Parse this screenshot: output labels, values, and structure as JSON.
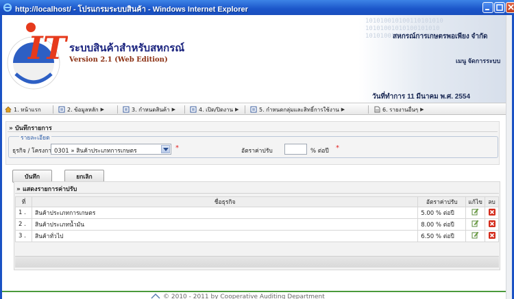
{
  "window": {
    "title": "http://localhost/ - โปรแกรมระบบสินค้า - Windows Internet Explorer"
  },
  "banner": {
    "app_title": "ระบบสินค้าสำหรับสหกรณ์",
    "version": "Version 2.1 (Web Edition)",
    "org_name": "สหกรณ์การเกษตรพอเพียง จำกัด",
    "user_menu": "เมนู จัดการระบบ",
    "work_date": "วันที่ทำการ 11 มีนาคม พ.ศ. 2554",
    "binary_bg": "101010010100110101010\n10101001010100101010\n1010100101010010101"
  },
  "menu": {
    "items": [
      {
        "label": "1. หน้าแรก",
        "icon": "home-icon"
      },
      {
        "label": "2. ข้อมูลหลัก",
        "icon": "form-icon"
      },
      {
        "label": "3. กำหนดสินค้า",
        "icon": "form-icon"
      },
      {
        "label": "4. เปิด/ปิดงาน",
        "icon": "form-icon"
      },
      {
        "label": "5. กำหนดกลุ่มและสิทธิ์การใช้งาน",
        "icon": "form-icon"
      },
      {
        "label": "6. รายงานอื่นๆ",
        "icon": "report-icon"
      }
    ]
  },
  "form": {
    "heading": "» บันทึกรายการ",
    "legend": "รายละเอียด",
    "business_label": "ธุรกิจ / โครงการ",
    "business_value": "0301 » สินค้าประเภทการเกษตร",
    "rate_label": "อัตราค่าปรับ",
    "rate_value": "",
    "rate_unit": "% ต่อปี",
    "required_mark": "*",
    "save_label": "บันทึก",
    "cancel_label": "ยกเลิก"
  },
  "list": {
    "heading": "» แสดงรายการค่าปรับ",
    "columns": {
      "no": "ที่",
      "name": "ชื่อธุรกิจ",
      "rate": "อัตราค่าปรับ",
      "edit": "แก้ไข",
      "delete": "ลบ"
    },
    "rows": [
      {
        "no": "1 .",
        "name": "สินค้าประเภทการเกษตร",
        "rate": "5.00 % ต่อปี"
      },
      {
        "no": "2 .",
        "name": "สินค้าประเภทน้ำมัน",
        "rate": "8.00 % ต่อปี"
      },
      {
        "no": "3 .",
        "name": "สินค้าทั่วไป",
        "rate": "6.50 % ต่อปี"
      }
    ]
  },
  "footer": {
    "text": "© 2010 - 2011 by Cooperative Auditing Department"
  },
  "colors": {
    "titlebar": "#1b55c9",
    "accent_blue": "#2f5fa8",
    "required": "#e32020",
    "footer_line": "#4a9a3b"
  }
}
